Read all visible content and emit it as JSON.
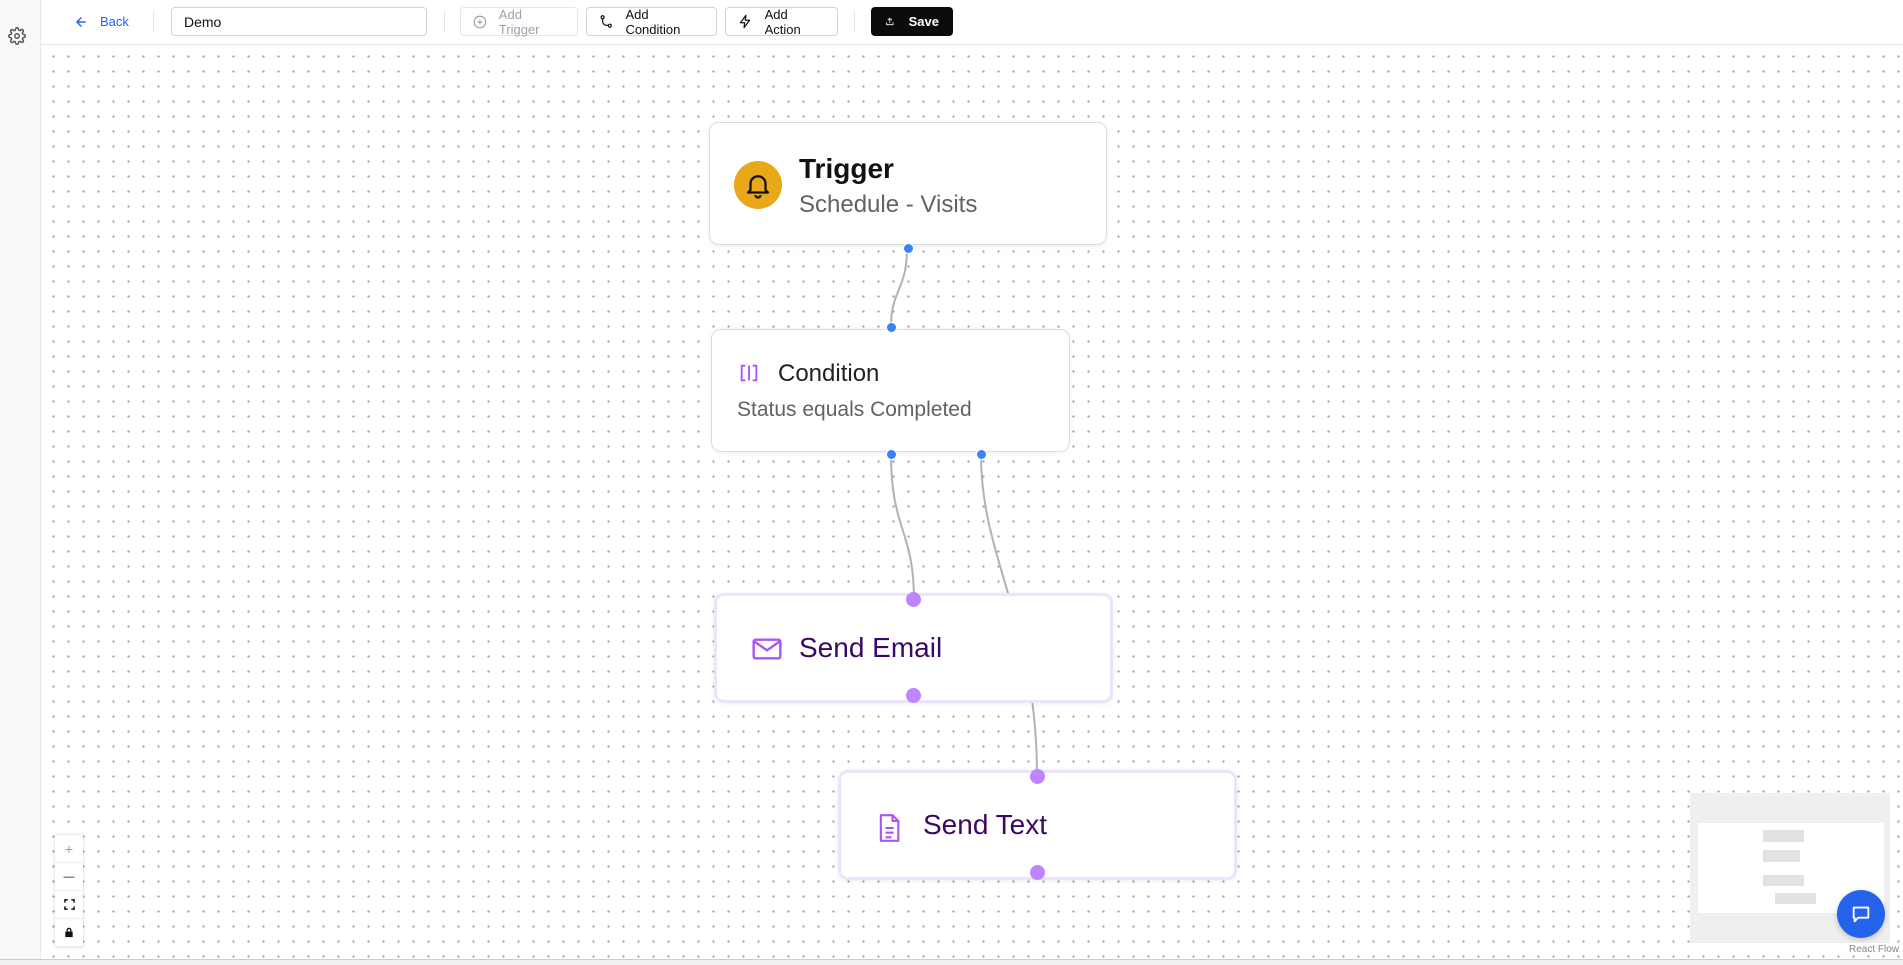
{
  "toolbar": {
    "back_label": "Back",
    "workflow_name": "Demo",
    "add_trigger_label": "Add Trigger",
    "add_condition_label": "Add Condition",
    "add_action_label": "Add Action",
    "save_label": "Save"
  },
  "nodes": {
    "trigger": {
      "title": "Trigger",
      "subtitle": "Schedule - Visits",
      "icon": "bell-icon"
    },
    "condition": {
      "title": "Condition",
      "subtitle": "Status equals Completed",
      "icon": "condition-icon"
    },
    "send_email": {
      "title": "Send Email",
      "icon": "mail-icon"
    },
    "send_text": {
      "title": "Send Text",
      "icon": "document-icon"
    }
  },
  "controls": {
    "zoom_in": "+",
    "zoom_out": "—"
  },
  "attribution": "React Flow",
  "colors": {
    "accent": "#2563eb",
    "trigger_icon_bg": "#e8a81a",
    "action_text": "#3b0764",
    "action_icon": "#a855f7",
    "edge": "#b1b1b7"
  }
}
